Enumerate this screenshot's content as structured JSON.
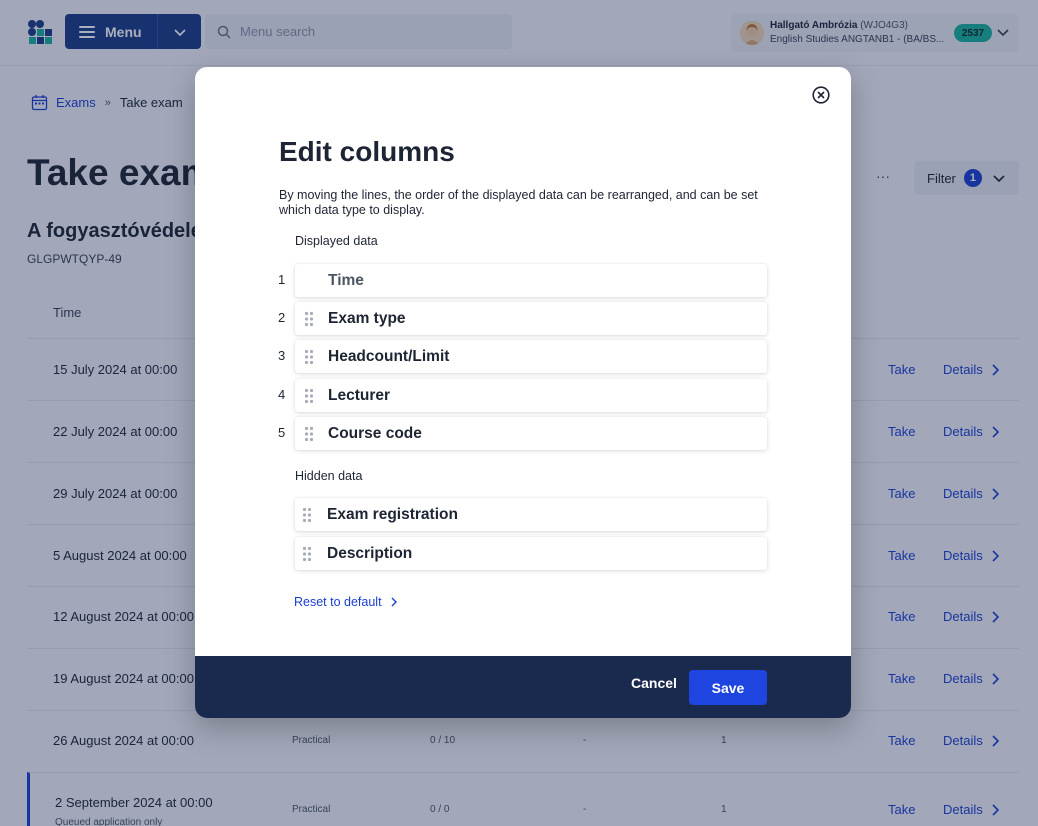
{
  "header": {
    "menu_label": "Menu",
    "search_placeholder": "Menu search",
    "user_name": "Hallgató Ambrózia",
    "user_code": "(WJO4G3)",
    "user_program": "English Studies ANGTANB1 - (BA/BS...",
    "user_badge": "2537"
  },
  "breadcrumb": {
    "parent": "Exams",
    "separator": "»",
    "current": "Take exam"
  },
  "page": {
    "title": "Take exam",
    "subtitle": "A fogyasztóvédelem",
    "course_code": "GLGPWTQYP-49",
    "more": "···",
    "filter_label": "Filter",
    "filter_count": "1",
    "column_time": "Time"
  },
  "rows": [
    {
      "time": "15 July 2024 at 00:00",
      "take": "Take",
      "details": "Details"
    },
    {
      "time": "22 July 2024 at 00:00",
      "take": "Take",
      "details": "Details"
    },
    {
      "time": "29 July 2024 at 00:00",
      "take": "Take",
      "details": "Details"
    },
    {
      "time": "5 August 2024 at 00:00",
      "take": "Take",
      "details": "Details"
    },
    {
      "time": "12 August 2024 at 00:00",
      "take": "Take",
      "details": "Details"
    },
    {
      "time": "19 August 2024 at 00:00",
      "take": "Take",
      "details": "Details"
    },
    {
      "time": "26 August 2024 at 00:00",
      "type": "Practical",
      "headcount": "0 / 10",
      "lecturer": "-",
      "course": "1",
      "take": "Take",
      "details": "Details"
    },
    {
      "time": "2 September 2024 at 00:00",
      "note": "Queued application only",
      "type": "Practical",
      "headcount": "0 / 0",
      "lecturer": "-",
      "course": "1",
      "take": "Take",
      "details": "Details"
    }
  ],
  "modal": {
    "title": "Edit columns",
    "description": "By moving the lines, the order of the displayed data can be rearranged, and can be set which data type to display.",
    "displayed_label": "Displayed data",
    "displayed": [
      {
        "num": "1",
        "label": "Time"
      },
      {
        "num": "2",
        "label": "Exam type"
      },
      {
        "num": "3",
        "label": "Headcount/Limit"
      },
      {
        "num": "4",
        "label": "Lecturer"
      },
      {
        "num": "5",
        "label": "Course code"
      }
    ],
    "hidden_label": "Hidden data",
    "hidden": [
      {
        "label": "Exam registration"
      },
      {
        "label": "Description"
      }
    ],
    "reset_label": "Reset to default",
    "cancel_label": "Cancel",
    "save_label": "Save"
  }
}
